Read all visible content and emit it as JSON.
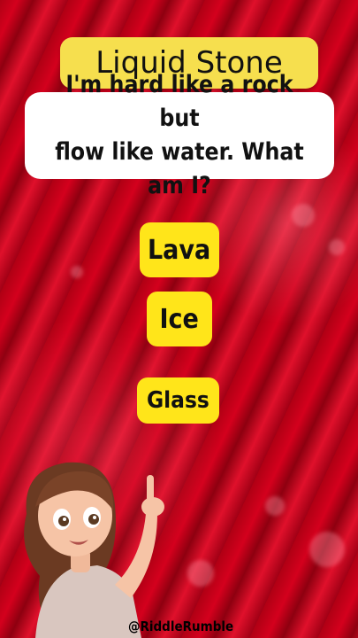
{
  "title": "Liquid Stone",
  "question": "I'm hard like a rock but\nflow like water. What am I?",
  "options": [
    "Lava",
    "Ice",
    "Glass"
  ],
  "watermark": "@RiddleRumble",
  "colors": {
    "background": "#b50016",
    "title_bg": "#f6df4e",
    "option_bg": "#ffe51a",
    "question_bg": "#ffffff"
  }
}
